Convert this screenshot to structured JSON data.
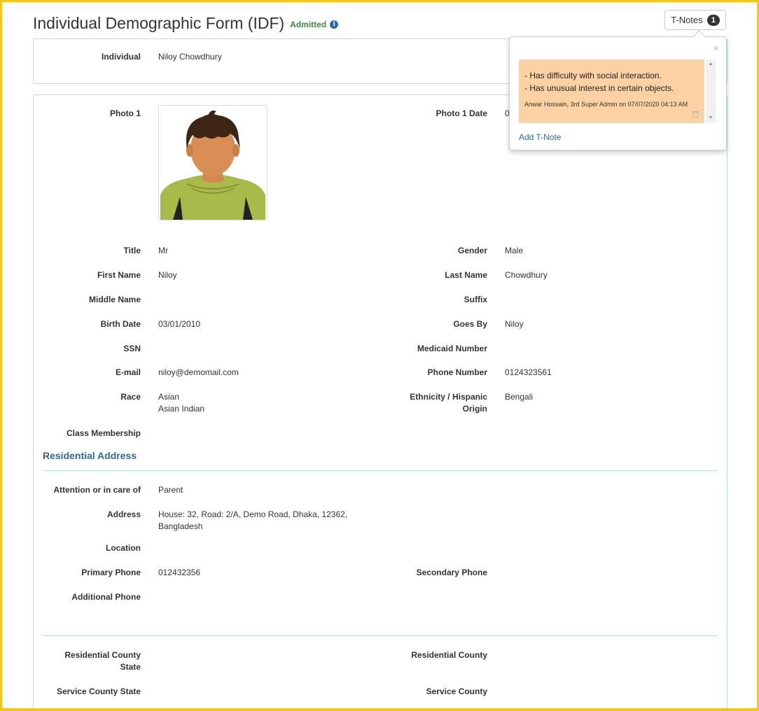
{
  "header": {
    "title": "Individual Demographic Form (IDF)",
    "status": "Admitted",
    "info_glyph": "i",
    "tnotes_label": "T-Notes",
    "tnotes_count": "1"
  },
  "individual": {
    "label": "Individual",
    "value": "Niloy Chowdhury"
  },
  "photo": {
    "label": "Photo 1",
    "date_label": "Photo 1 Date",
    "date_value_partial": "0"
  },
  "fields": {
    "title": {
      "label": "Title",
      "value": "Mr"
    },
    "gender": {
      "label": "Gender",
      "value": "Male"
    },
    "first_name": {
      "label": "First Name",
      "value": "Niloy"
    },
    "last_name": {
      "label": "Last Name",
      "value": "Chowdhury"
    },
    "middle_name": {
      "label": "Middle Name",
      "value": ""
    },
    "suffix": {
      "label": "Suffix",
      "value": ""
    },
    "birth_date": {
      "label": "Birth Date",
      "value": "03/01/2010"
    },
    "goes_by": {
      "label": "Goes By",
      "value": "Niloy"
    },
    "ssn": {
      "label": "SSN",
      "value": ""
    },
    "medicaid": {
      "label": "Medicaid Number",
      "value": ""
    },
    "email": {
      "label": "E-mail",
      "value": "niloy@demomail.com"
    },
    "phone": {
      "label": "Phone Number",
      "value": "0124323561"
    },
    "race": {
      "label": "Race",
      "value_1": "Asian",
      "value_2": "Asian Indian"
    },
    "ethnicity": {
      "label_1": "Ethnicity / Hispanic",
      "label_2": "Origin",
      "value": "Bengali"
    },
    "class_membership": {
      "label": "Class Membership",
      "value": ""
    }
  },
  "residential": {
    "heading": "Residential Address",
    "attention": {
      "label": "Attention or in care of",
      "value": "Parent"
    },
    "address": {
      "label": "Address",
      "value_1": "House: 32, Road: 2/A, Demo Road, Dhaka, 12362,",
      "value_2": "Bangladesh"
    },
    "location": {
      "label": "Location",
      "value": ""
    },
    "primary_phone": {
      "label": "Primary Phone",
      "value": "012432356"
    },
    "secondary_phone": {
      "label": "Secondary Phone",
      "value": ""
    },
    "additional_phone": {
      "label": "Additional Phone",
      "value": ""
    }
  },
  "county": {
    "res_county_state": {
      "label_1": "Residential County",
      "label_2": "State"
    },
    "res_county": {
      "label": "Residential County"
    },
    "service_county_state": {
      "label": "Service County State"
    },
    "service_county": {
      "label": "Service County"
    }
  },
  "tnotes_popover": {
    "close_glyph": "×",
    "note_line_1": "- Has difficulty with social interaction.",
    "note_line_2": "- Has unusual interest in certain objects.",
    "note_meta": "Anwar Hossain, 3rd Super Admin on 07/07/2020 04:13 AM",
    "add_label": "Add T-Note",
    "note_color": "#fcd1a4"
  },
  "colors": {
    "accent": "#2d6c8e",
    "status_green": "#3c8a3c",
    "border": "#b9dbe6",
    "frame": "#f5c518"
  },
  "icons": {
    "info": "info-icon",
    "close": "close-icon",
    "trash": "trash-icon",
    "avatar": "avatar-illustration"
  }
}
